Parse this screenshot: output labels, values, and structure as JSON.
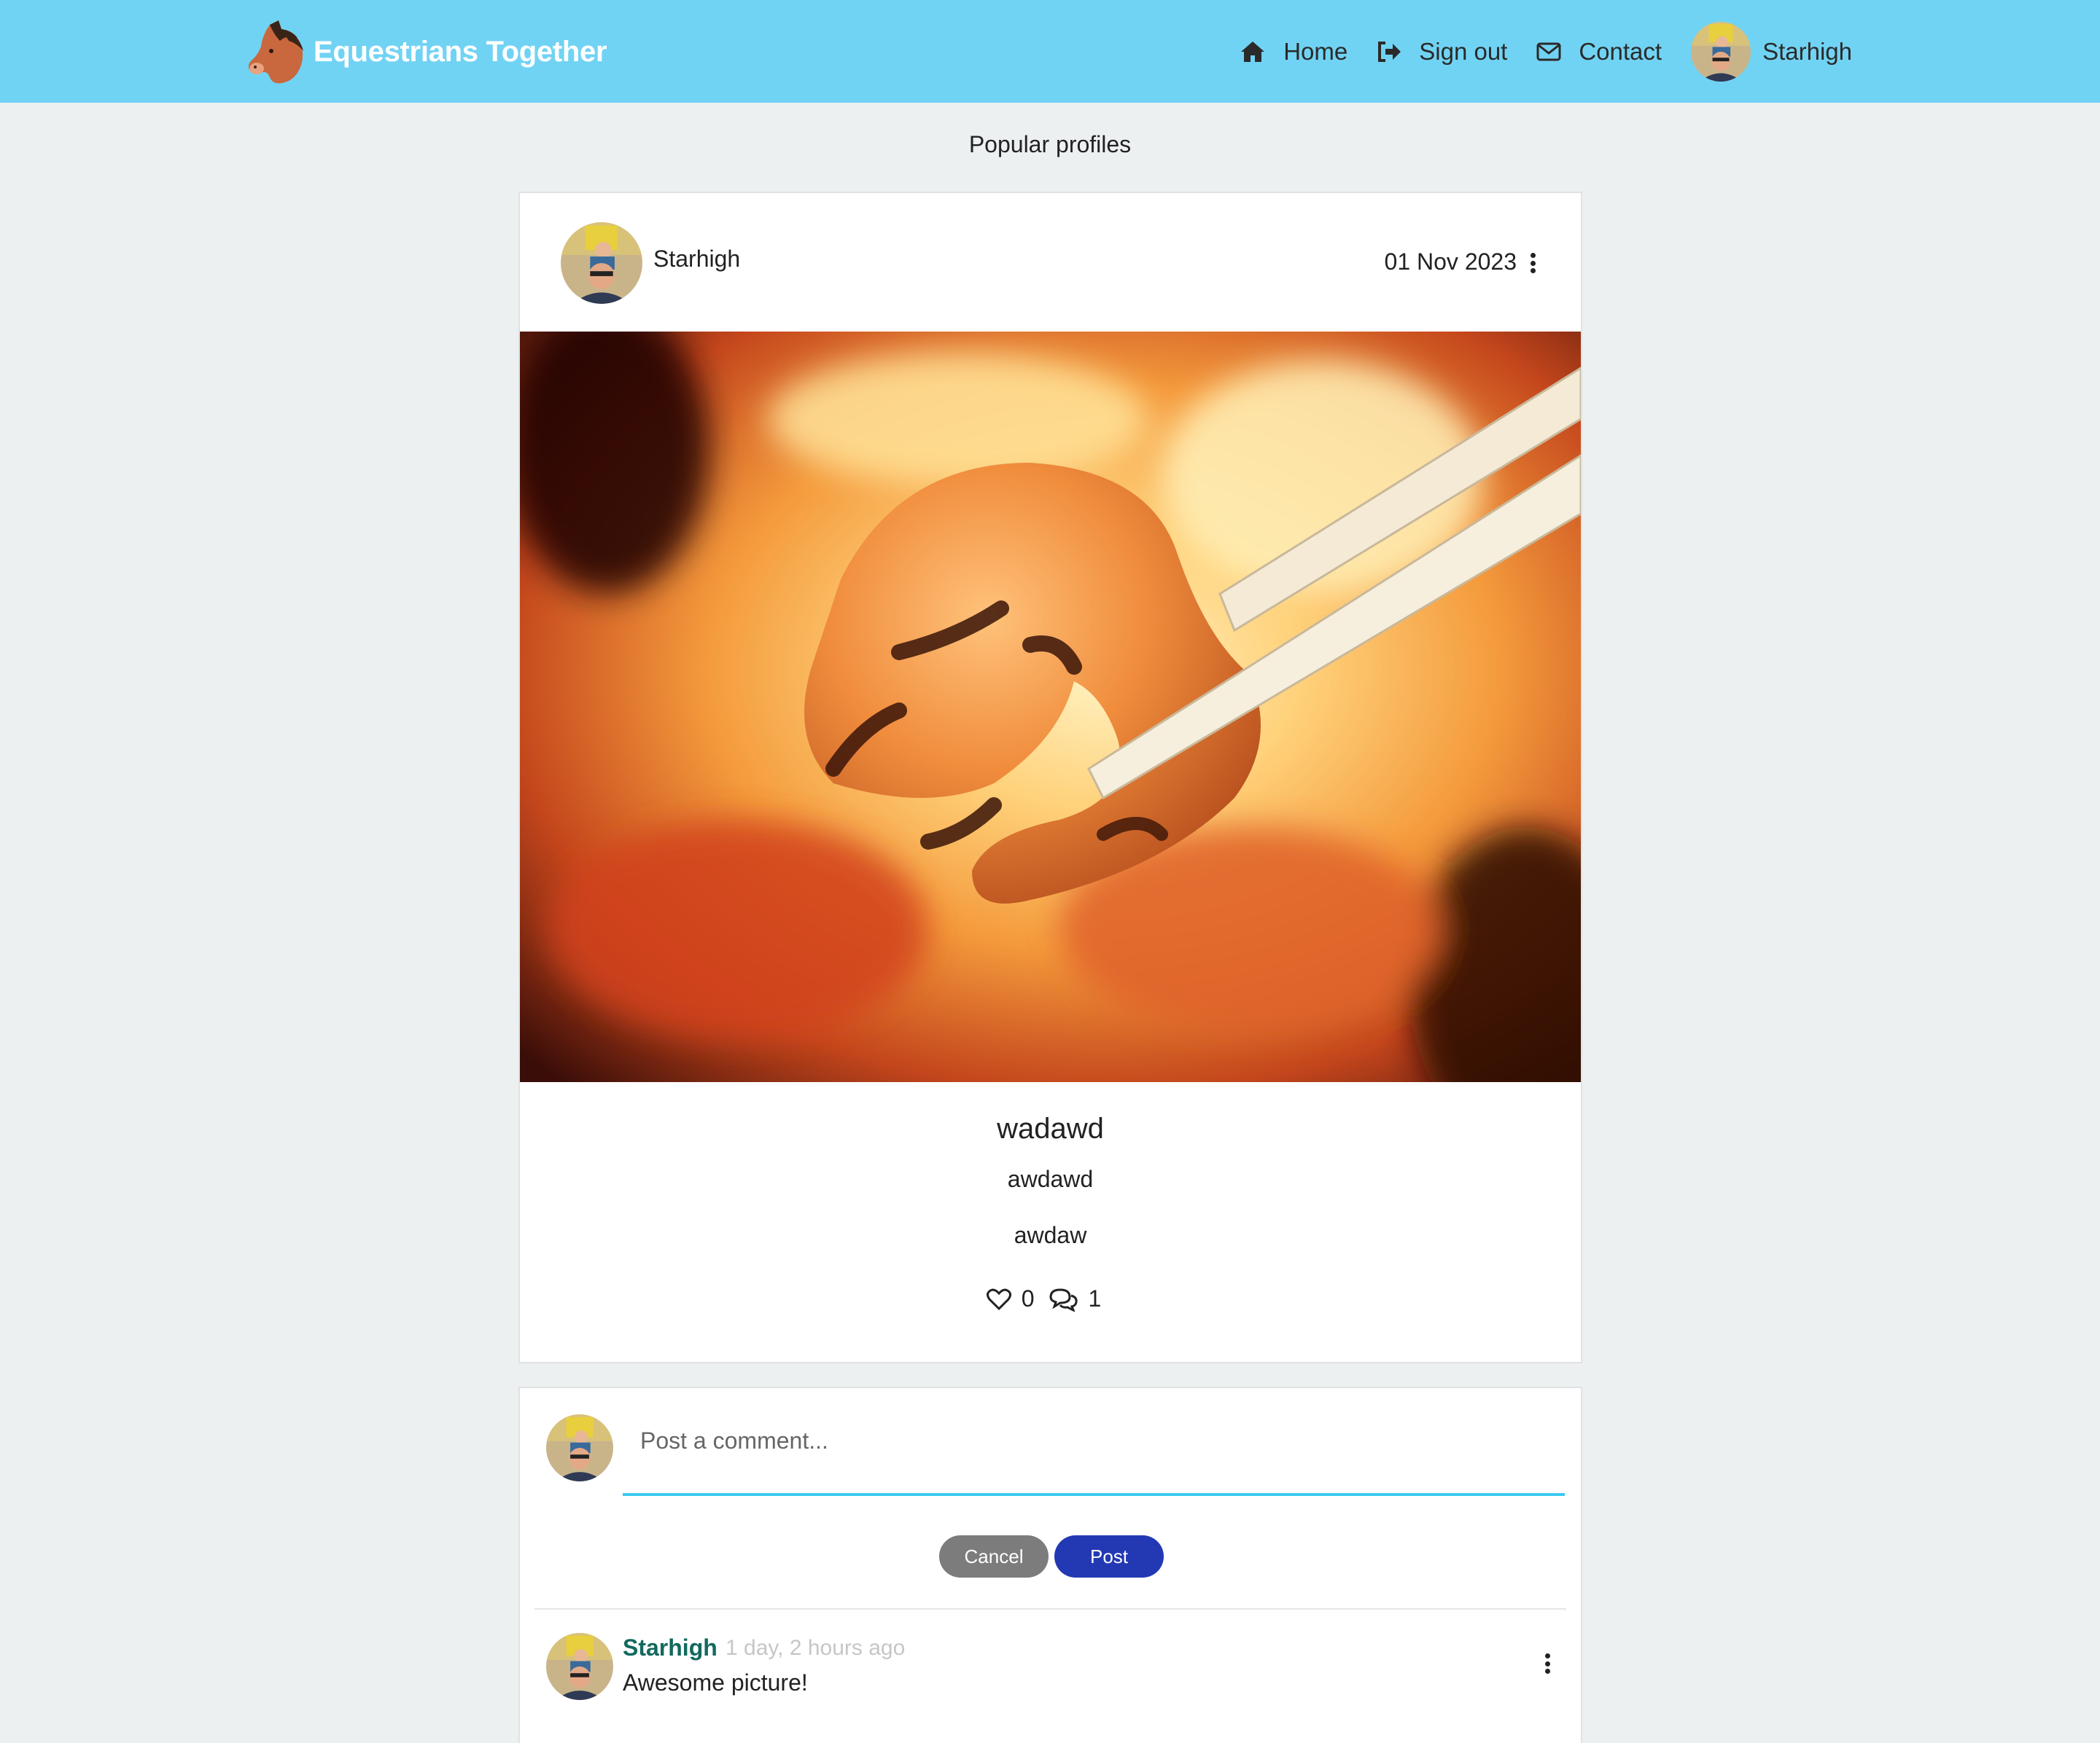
{
  "navbar": {
    "brand": "Equestrians Together",
    "links": {
      "home": "Home",
      "signout": "Sign out",
      "contact": "Contact",
      "profile": "Starhigh"
    }
  },
  "popular": {
    "heading": "Popular profiles"
  },
  "post": {
    "owner": "Starhigh",
    "date": "01 Nov 2023",
    "title": "wadawd",
    "subtitle": "awdawd",
    "content": "awdaw",
    "likes": "0",
    "comments": "1"
  },
  "comment_form": {
    "placeholder": "Post a comment...",
    "cancel_label": "Cancel",
    "post_label": "Post"
  },
  "comments": [
    {
      "owner": "Starhigh",
      "time": "1 day, 2 hours ago",
      "text": "Awesome picture!"
    }
  ],
  "colors": {
    "navbar_bg": "#71d3f3",
    "page_bg": "#ecf0f1",
    "post_button": "#2339b4",
    "cancel_button": "#7c7c7c",
    "comment_owner": "#126a5e",
    "input_underline": "#3ccaef"
  },
  "icons": [
    "horse-logo-icon",
    "home-icon",
    "sign-out-icon",
    "envelope-icon",
    "heart-icon",
    "comments-icon",
    "vertical-dots-icon"
  ]
}
